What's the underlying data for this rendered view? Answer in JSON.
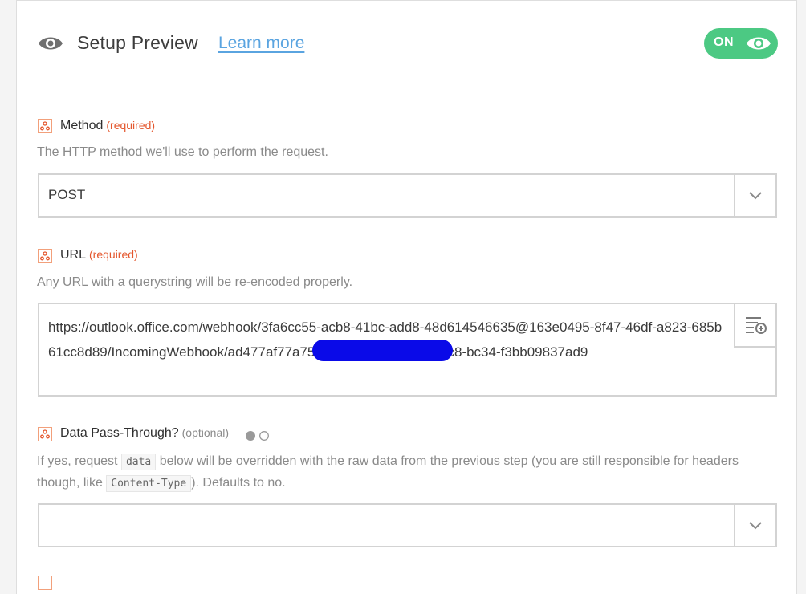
{
  "header": {
    "title": "Setup Preview",
    "learn_more": "Learn more",
    "toggle_label": "ON"
  },
  "colors": {
    "accent_green": "#4cc983",
    "link_blue": "#5aa4e0",
    "required_red": "#e4572e",
    "icon_orange": "#f2a07b"
  },
  "fields": {
    "method": {
      "label": "Method",
      "tag": "(required)",
      "help": "The HTTP method we'll use to perform the request.",
      "value": "POST"
    },
    "url": {
      "label": "URL",
      "tag": "(required)",
      "help": "Any URL with a querystring will be re-encoded properly.",
      "value": "https://outlook.office.com/webhook/3fa6cc55-acb8-41bc-add8-48d614546635@163e0495-8f47-46df-a823-685b61cc8d89/IncomingWebhook/ad477af77a7526/11dbad4c-aa00-44c8-bc34-f3bb09837ad9"
    },
    "passthrough": {
      "label": "Data Pass-Through?",
      "tag": "(optional)",
      "help_pre": "If yes, request ",
      "help_code1": "data",
      "help_mid": " below will be overridden with the raw data from the previous step (you are still responsible for headers though, like ",
      "help_code2": "Content-Type",
      "help_post": "). Defaults to no.",
      "value": ""
    }
  }
}
